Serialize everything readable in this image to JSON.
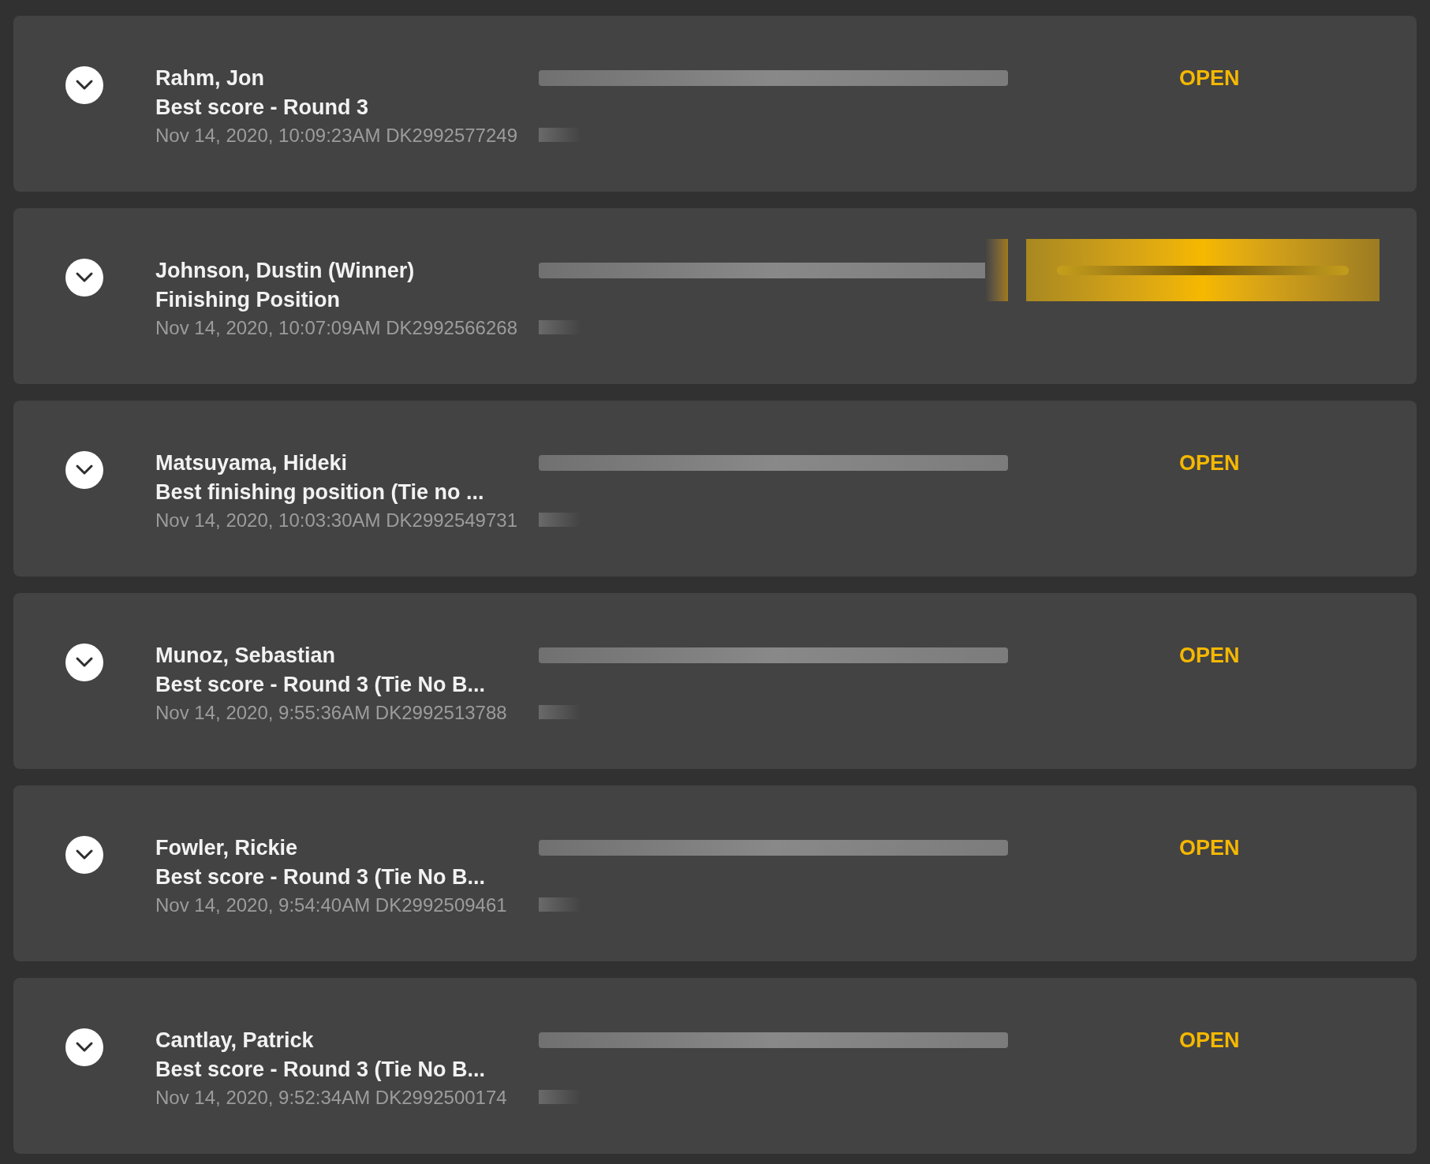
{
  "bets": [
    {
      "name": "Rahm, Jon",
      "market": "Best score - Round 3",
      "placed": "Nov 14, 2020, 10:09:23AM DK2992577249",
      "kind": "status",
      "status": "OPEN"
    },
    {
      "name": "Johnson, Dustin (Winner)",
      "market": "Finishing Position",
      "placed": "Nov 14, 2020, 10:07:09AM DK2992566268",
      "kind": "button"
    },
    {
      "name": "Matsuyama, Hideki",
      "market": "Best finishing position (Tie no ...",
      "placed": "Nov 14, 2020, 10:03:30AM DK2992549731",
      "kind": "status",
      "status": "OPEN"
    },
    {
      "name": "Munoz, Sebastian",
      "market": "Best score - Round 3 (Tie No B...",
      "placed": "Nov 14, 2020, 9:55:36AM DK2992513788",
      "kind": "status",
      "status": "OPEN"
    },
    {
      "name": "Fowler, Rickie",
      "market": "Best score - Round 3 (Tie No B...",
      "placed": "Nov 14, 2020, 9:54:40AM DK2992509461",
      "kind": "status",
      "status": "OPEN"
    },
    {
      "name": "Cantlay, Patrick",
      "market": "Best score - Round 3 (Tie No B...",
      "placed": "Nov 14, 2020, 9:52:34AM DK2992500174",
      "kind": "status",
      "status": "OPEN"
    }
  ]
}
